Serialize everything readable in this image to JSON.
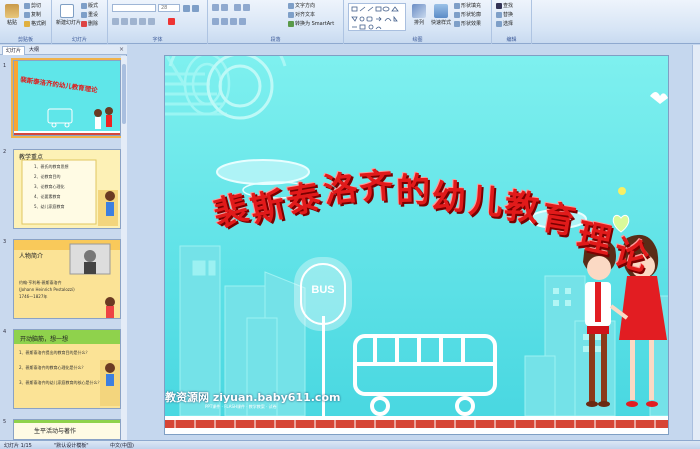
{
  "ribbon": {
    "clipboard": {
      "paste": "粘贴",
      "cut": "剪切",
      "copy": "复制",
      "format_painter": "格式刷",
      "group": "剪贴板"
    },
    "slides": {
      "new_slide": "新建幻灯片",
      "layout": "版式",
      "reset": "重设",
      "delete": "删除",
      "group": "幻灯片"
    },
    "font": {
      "size": "28",
      "group": "字体"
    },
    "paragraph": {
      "text_direction": "文字方向",
      "align_text": "对齐文本",
      "smartart": "转换为 SmartArt",
      "group": "段落"
    },
    "drawing": {
      "arrange": "排列",
      "quick_styles": "快速样式",
      "shape_fill": "形状填充",
      "shape_outline": "形状轮廓",
      "shape_effects": "形状效果",
      "group": "绘图"
    },
    "editing": {
      "find": "查找",
      "replace": "替换",
      "select": "选择",
      "group": "编辑"
    }
  },
  "panel": {
    "tab_slides": "幻灯片",
    "tab_outline": "大纲",
    "close": "×",
    "thumbs": [
      {
        "num": "1",
        "title": "裴斯泰洛齐的幼儿教育理论"
      },
      {
        "num": "2",
        "title": "教学重点",
        "lines": [
          "1、裴氏的教育思想",
          "2、论教育目的",
          "3、论教育心理化",
          "4、论要素教育",
          "5、幼儿家庭教育"
        ]
      },
      {
        "num": "3",
        "title": "人物简介",
        "lines": [
          "约翰·亨利希·裴斯泰洛齐",
          "(Johann Heinrich Pestalozzi)",
          "1746—1827年"
        ]
      },
      {
        "num": "4",
        "title": "开动脑筋，想一想",
        "lines": [
          "1、裴斯泰洛齐提出的教育目的是什么？",
          "2、裴斯泰洛齐的教育心理化是什么？",
          "3、裴斯泰洛齐的幼儿家庭教育的核心是什么？"
        ]
      },
      {
        "num": "5",
        "title": "生平活动与著作"
      }
    ]
  },
  "slide": {
    "title": "裴斯泰洛齐的幼儿教育理论",
    "bus_sign": "BUS",
    "watermark": "教资源网 ziyuan.baby611.com",
    "watermark_sub": "PPT课件 · FLASH课件 · 教学教案 · 试卷"
  },
  "status": {
    "slide_pos": "幻灯片 1/15",
    "theme": "\"默认设计模板\"",
    "language": "中文(中国)"
  },
  "colors": {
    "slide_bg": "#5fe6e9",
    "title_red": "#e11a1a",
    "ribbon_bg": "#d6e4f5"
  }
}
